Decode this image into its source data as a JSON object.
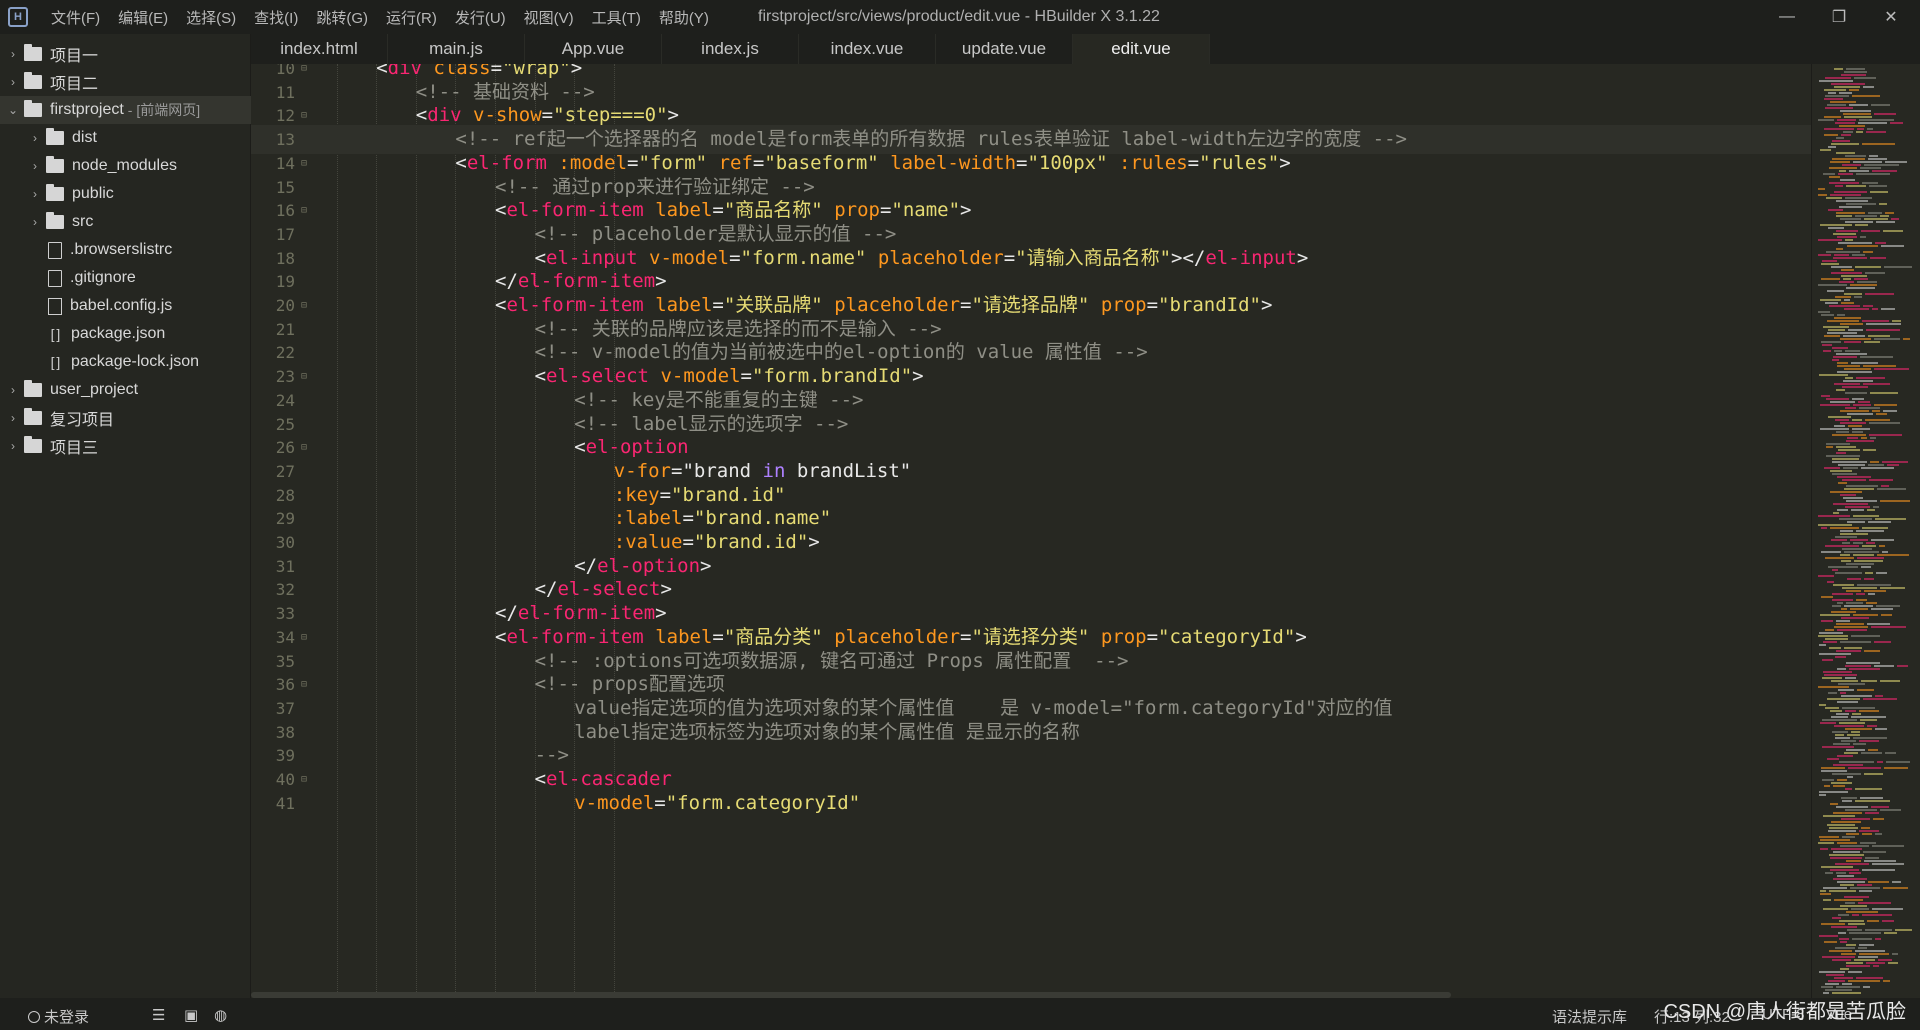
{
  "app": {
    "window_title": "firstproject/src/views/product/edit.vue - HBuilder X 3.1.22",
    "logo_letter": "H"
  },
  "menu": [
    "文件(F)",
    "编辑(E)",
    "选择(S)",
    "查找(I)",
    "跳转(G)",
    "运行(R)",
    "发行(U)",
    "视图(V)",
    "工具(T)",
    "帮助(Y)"
  ],
  "window_controls": {
    "minimize": "—",
    "restore": "❐",
    "close": "✕"
  },
  "tabs": [
    "index.html",
    "main.js",
    "App.vue",
    "index.js",
    "index.vue",
    "update.vue",
    "edit.vue"
  ],
  "active_tab": "edit.vue",
  "tree": [
    {
      "label": "项目一",
      "type": "project",
      "arrow": "›",
      "depth": 0
    },
    {
      "label": "项目二",
      "type": "project",
      "arrow": "›",
      "depth": 0
    },
    {
      "label": "firstproject",
      "sub": "- [前端网页]",
      "type": "project",
      "arrow": "⌄",
      "depth": 0,
      "selected": true
    },
    {
      "label": "dist",
      "type": "folder",
      "arrow": "›",
      "depth": 1
    },
    {
      "label": "node_modules",
      "type": "folder",
      "arrow": "›",
      "depth": 1
    },
    {
      "label": "public",
      "type": "folder",
      "arrow": "›",
      "depth": 1
    },
    {
      "label": "src",
      "type": "folder",
      "arrow": "›",
      "depth": 1
    },
    {
      "label": ".browserslistrc",
      "type": "file",
      "arrow": "",
      "depth": 1
    },
    {
      "label": ".gitignore",
      "type": "file",
      "arrow": "",
      "depth": 1
    },
    {
      "label": "babel.config.js",
      "type": "js",
      "arrow": "",
      "depth": 1
    },
    {
      "label": "package.json",
      "type": "json",
      "arrow": "",
      "depth": 1
    },
    {
      "label": "package-lock.json",
      "type": "json",
      "arrow": "",
      "depth": 1
    },
    {
      "label": "user_project",
      "type": "project",
      "arrow": "›",
      "depth": 0
    },
    {
      "label": "复习项目",
      "type": "project",
      "arrow": "›",
      "depth": 0
    },
    {
      "label": "项目三",
      "type": "project",
      "arrow": "›",
      "depth": 0
    }
  ],
  "code": {
    "current_line": 13,
    "lines": [
      {
        "n": 10,
        "fold": true,
        "indent": 2,
        "tokens": [
          [
            "t",
            "<"
          ],
          [
            "tag",
            "div"
          ],
          [
            "t",
            " "
          ],
          [
            "attr",
            "class"
          ],
          [
            "t",
            "="
          ],
          [
            "str",
            "\"wrap\""
          ],
          [
            "t",
            ">"
          ]
        ]
      },
      {
        "n": 11,
        "indent": 3,
        "tokens": [
          [
            "cm",
            "<!-- 基础资料 -->"
          ]
        ]
      },
      {
        "n": 12,
        "fold": true,
        "indent": 3,
        "tokens": [
          [
            "t",
            "<"
          ],
          [
            "tag",
            "div"
          ],
          [
            "t",
            " "
          ],
          [
            "attr",
            "v-show"
          ],
          [
            "t",
            "="
          ],
          [
            "str",
            "\"step===0\""
          ],
          [
            "t",
            ">"
          ]
        ]
      },
      {
        "n": 13,
        "indent": 4,
        "tokens": [
          [
            "cm",
            "<!-- ref起一个选择器的名 model是form表单的所有数据 rules表单验证 label-width左边字的宽度 -->"
          ]
        ]
      },
      {
        "n": 14,
        "fold": true,
        "indent": 4,
        "tokens": [
          [
            "t",
            "<"
          ],
          [
            "tag",
            "el-form"
          ],
          [
            "t",
            " "
          ],
          [
            "attr",
            ":model"
          ],
          [
            "t",
            "="
          ],
          [
            "str",
            "\"form\""
          ],
          [
            "t",
            " "
          ],
          [
            "attr",
            "ref"
          ],
          [
            "t",
            "="
          ],
          [
            "str",
            "\"baseform\""
          ],
          [
            "t",
            " "
          ],
          [
            "attr",
            "label-width"
          ],
          [
            "t",
            "="
          ],
          [
            "str",
            "\"100px\""
          ],
          [
            "t",
            " "
          ],
          [
            "attr",
            ":rules"
          ],
          [
            "t",
            "="
          ],
          [
            "str",
            "\"rules\""
          ],
          [
            "t",
            ">"
          ]
        ]
      },
      {
        "n": 15,
        "indent": 5,
        "tokens": [
          [
            "cm",
            "<!-- 通过prop来进行验证绑定 -->"
          ]
        ]
      },
      {
        "n": 16,
        "fold": true,
        "indent": 5,
        "tokens": [
          [
            "t",
            "<"
          ],
          [
            "tag",
            "el-form-item"
          ],
          [
            "t",
            " "
          ],
          [
            "attr",
            "label"
          ],
          [
            "t",
            "="
          ],
          [
            "str",
            "\"商品名称\""
          ],
          [
            "t",
            " "
          ],
          [
            "attr",
            "prop"
          ],
          [
            "t",
            "="
          ],
          [
            "str",
            "\"name\""
          ],
          [
            "t",
            ">"
          ]
        ]
      },
      {
        "n": 17,
        "indent": 6,
        "tokens": [
          [
            "cm",
            "<!-- placeholder是默认显示的值 -->"
          ]
        ]
      },
      {
        "n": 18,
        "indent": 6,
        "tokens": [
          [
            "t",
            "<"
          ],
          [
            "tag",
            "el-input"
          ],
          [
            "t",
            " "
          ],
          [
            "attr",
            "v-model"
          ],
          [
            "t",
            "="
          ],
          [
            "str",
            "\"form.name\""
          ],
          [
            "t",
            " "
          ],
          [
            "attr",
            "placeholder"
          ],
          [
            "t",
            "="
          ],
          [
            "str",
            "\"请输入商品名称\""
          ],
          [
            "t",
            "></"
          ],
          [
            "tag",
            "el-input"
          ],
          [
            "t",
            ">"
          ]
        ]
      },
      {
        "n": 19,
        "indent": 5,
        "tokens": [
          [
            "t",
            "</"
          ],
          [
            "tag",
            "el-form-item"
          ],
          [
            "t",
            ">"
          ]
        ]
      },
      {
        "n": 20,
        "fold": true,
        "indent": 5,
        "tokens": [
          [
            "t",
            "<"
          ],
          [
            "tag",
            "el-form-item"
          ],
          [
            "t",
            " "
          ],
          [
            "attr",
            "label"
          ],
          [
            "t",
            "="
          ],
          [
            "str",
            "\"关联品牌\""
          ],
          [
            "t",
            " "
          ],
          [
            "attr",
            "placeholder"
          ],
          [
            "t",
            "="
          ],
          [
            "str",
            "\"请选择品牌\""
          ],
          [
            "t",
            " "
          ],
          [
            "attr",
            "prop"
          ],
          [
            "t",
            "="
          ],
          [
            "str",
            "\"brandId\""
          ],
          [
            "t",
            ">"
          ]
        ]
      },
      {
        "n": 21,
        "indent": 6,
        "tokens": [
          [
            "cm",
            "<!-- 关联的品牌应该是选择的而不是输入 -->"
          ]
        ]
      },
      {
        "n": 22,
        "indent": 6,
        "tokens": [
          [
            "cm",
            "<!-- v-model的值为当前被选中的el-option的 value 属性值 -->"
          ]
        ]
      },
      {
        "n": 23,
        "fold": true,
        "indent": 6,
        "tokens": [
          [
            "t",
            "<"
          ],
          [
            "tag",
            "el-select"
          ],
          [
            "t",
            " "
          ],
          [
            "attr",
            "v-model"
          ],
          [
            "t",
            "="
          ],
          [
            "str",
            "\"form.brandId\""
          ],
          [
            "t",
            ">"
          ]
        ]
      },
      {
        "n": 24,
        "indent": 7,
        "tokens": [
          [
            "cm",
            "<!-- key是不能重复的主键 -->"
          ]
        ]
      },
      {
        "n": 25,
        "indent": 7,
        "tokens": [
          [
            "cm",
            "<!-- label显示的选项字 -->"
          ]
        ]
      },
      {
        "n": 26,
        "fold": true,
        "indent": 7,
        "tokens": [
          [
            "t",
            "<"
          ],
          [
            "tag",
            "el-option"
          ]
        ]
      },
      {
        "n": 27,
        "indent": 8,
        "tokens": [
          [
            "attr",
            "v-for"
          ],
          [
            "t",
            "="
          ],
          [
            "plain",
            "\"brand "
          ],
          [
            "kw",
            "in"
          ],
          [
            "plain",
            " brandList\""
          ]
        ]
      },
      {
        "n": 28,
        "indent": 8,
        "tokens": [
          [
            "attr",
            ":key"
          ],
          [
            "t",
            "="
          ],
          [
            "str",
            "\"brand.id\""
          ]
        ]
      },
      {
        "n": 29,
        "indent": 8,
        "tokens": [
          [
            "attr",
            ":label"
          ],
          [
            "t",
            "="
          ],
          [
            "str",
            "\"brand.name\""
          ]
        ]
      },
      {
        "n": 30,
        "indent": 8,
        "tokens": [
          [
            "attr",
            ":value"
          ],
          [
            "t",
            "="
          ],
          [
            "str",
            "\"brand.id\""
          ],
          [
            "t",
            ">"
          ]
        ]
      },
      {
        "n": 31,
        "indent": 7,
        "tokens": [
          [
            "t",
            "</"
          ],
          [
            "tag",
            "el-option"
          ],
          [
            "t",
            ">"
          ]
        ]
      },
      {
        "n": 32,
        "indent": 6,
        "tokens": [
          [
            "t",
            "</"
          ],
          [
            "tag",
            "el-select"
          ],
          [
            "t",
            ">"
          ]
        ]
      },
      {
        "n": 33,
        "indent": 5,
        "tokens": [
          [
            "t",
            "</"
          ],
          [
            "tag",
            "el-form-item"
          ],
          [
            "t",
            ">"
          ]
        ]
      },
      {
        "n": 34,
        "fold": true,
        "indent": 5,
        "tokens": [
          [
            "t",
            "<"
          ],
          [
            "tag",
            "el-form-item"
          ],
          [
            "t",
            " "
          ],
          [
            "attr",
            "label"
          ],
          [
            "t",
            "="
          ],
          [
            "str",
            "\"商品分类\""
          ],
          [
            "t",
            " "
          ],
          [
            "attr",
            "placeholder"
          ],
          [
            "t",
            "="
          ],
          [
            "str",
            "\"请选择分类\""
          ],
          [
            "t",
            " "
          ],
          [
            "attr",
            "prop"
          ],
          [
            "t",
            "="
          ],
          [
            "str",
            "\"categoryId\""
          ],
          [
            "t",
            ">"
          ]
        ]
      },
      {
        "n": 35,
        "indent": 6,
        "tokens": [
          [
            "cm",
            "<!-- :options可选项数据源, 键名可通过 Props 属性配置  -->"
          ]
        ]
      },
      {
        "n": 36,
        "fold": true,
        "indent": 6,
        "tokens": [
          [
            "cm",
            "<!-- props配置选项"
          ]
        ]
      },
      {
        "n": 37,
        "indent": 7,
        "tokens": [
          [
            "cm",
            "value指定选项的值为选项对象的某个属性值    是 v-model=\"form.categoryId\"对应的值"
          ]
        ]
      },
      {
        "n": 38,
        "indent": 7,
        "tokens": [
          [
            "cm",
            "label指定选项标签为选项对象的某个属性值 是显示的名称"
          ]
        ]
      },
      {
        "n": 39,
        "indent": 6,
        "tokens": [
          [
            "cm",
            "-->"
          ]
        ]
      },
      {
        "n": 40,
        "fold": true,
        "indent": 6,
        "tokens": [
          [
            "t",
            "<"
          ],
          [
            "tag",
            "el-cascader"
          ]
        ]
      },
      {
        "n": 41,
        "indent": 7,
        "tokens": [
          [
            "attr",
            "v-model"
          ],
          [
            "t",
            "="
          ],
          [
            "str",
            "\"form.categoryId\""
          ]
        ]
      }
    ]
  },
  "statusbar": {
    "user": "未登录",
    "hint": "语法提示库",
    "position": "行:13  列:32",
    "encoding": "UTF-8",
    "lang": "Vue"
  },
  "watermark": "CSDN @唐人街都是苦瓜脸",
  "colors": {
    "background": "#272822",
    "tag": "#f92672",
    "attr": "#fd971f",
    "string": "#e6db74",
    "comment": "#8f8f86",
    "keyword": "#ae81ff"
  }
}
